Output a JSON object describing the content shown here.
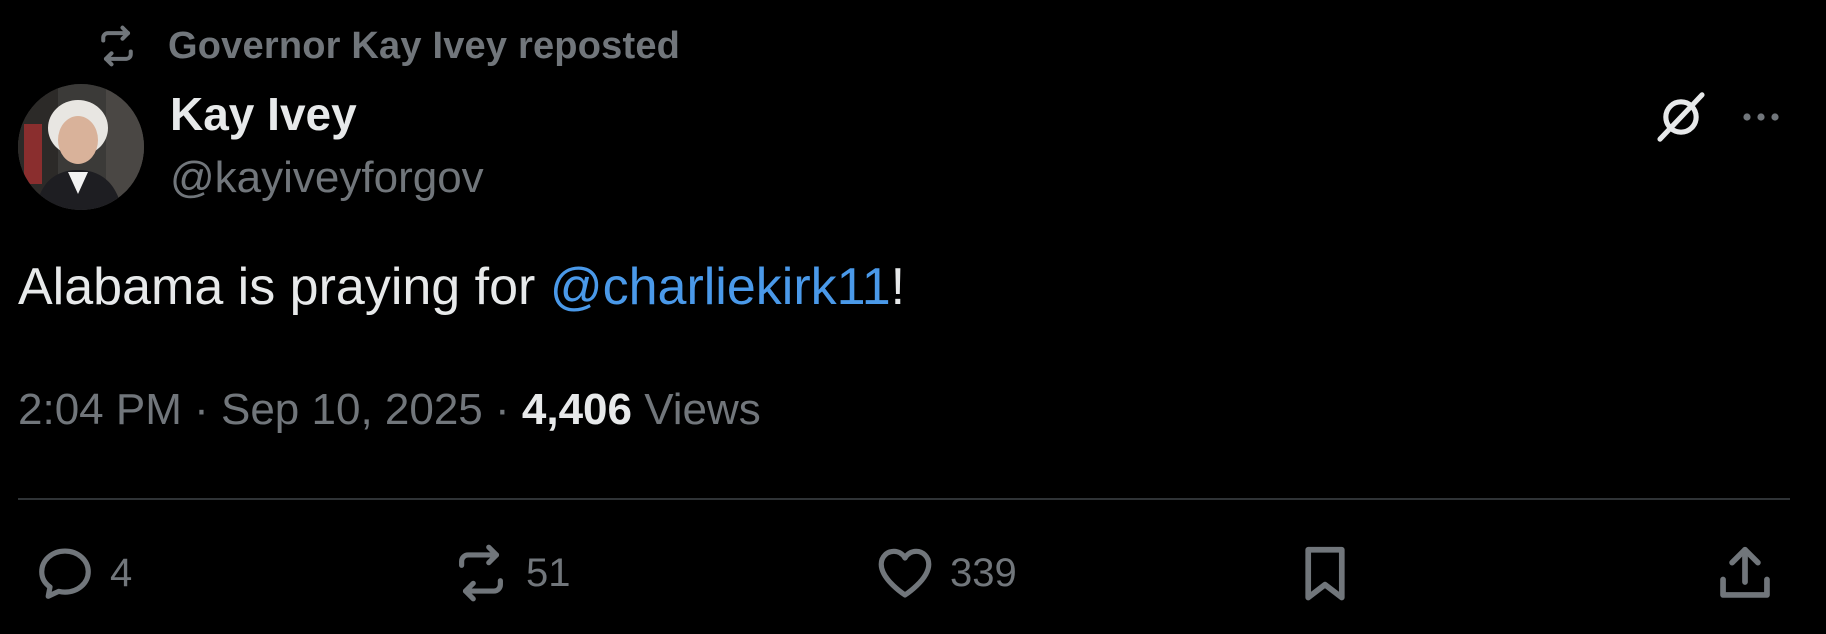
{
  "repost": {
    "label": "Governor Kay Ivey reposted",
    "icon": "repost-icon"
  },
  "author": {
    "display_name": "Kay Ivey",
    "handle": "@kayiveyforgov",
    "avatar_icon": "avatar-photo"
  },
  "header_actions": {
    "grok_icon": "grok-icon",
    "more_icon": "more-options-icon"
  },
  "tweet": {
    "text_before": "Alabama is praying for ",
    "mention": "@charliekirk11",
    "text_after": "!"
  },
  "meta": {
    "time": "2:04 PM",
    "separator1": " · ",
    "date": "Sep 10, 2025",
    "separator2": " · ",
    "views_count": "4,406",
    "views_label": " Views"
  },
  "actions": {
    "reply": {
      "icon": "reply-icon",
      "count": "4"
    },
    "retweet": {
      "icon": "retweet-icon",
      "count": "51"
    },
    "like": {
      "icon": "heart-icon",
      "count": "339"
    },
    "bookmark": {
      "icon": "bookmark-icon"
    },
    "share": {
      "icon": "share-icon"
    }
  },
  "colors": {
    "background": "#000000",
    "text_primary": "#e7e9ea",
    "text_secondary": "#71767b",
    "link": "#4a99e9",
    "divider": "#2f3336"
  }
}
